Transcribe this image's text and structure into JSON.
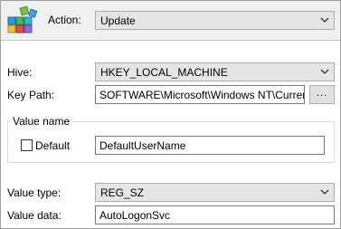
{
  "action": {
    "label": "Action:",
    "value": "Update"
  },
  "hive": {
    "label": "Hive:",
    "value": "HKEY_LOCAL_MACHINE"
  },
  "key_path": {
    "label": "Key Path:",
    "value": "SOFTWARE\\Microsoft\\Windows NT\\CurrentVersion\\Winlogon",
    "browse_label": "..."
  },
  "value_name": {
    "group_title": "Value name",
    "default_label": "Default",
    "default_checked": false,
    "value": "DefaultUserName"
  },
  "value_type": {
    "label": "Value type:",
    "value": "REG_SZ"
  },
  "value_data": {
    "label": "Value data:",
    "value": "AutoLogonSvc"
  },
  "icons": {
    "header": "registry-icon",
    "dropdown": "chevron-down-icon"
  }
}
